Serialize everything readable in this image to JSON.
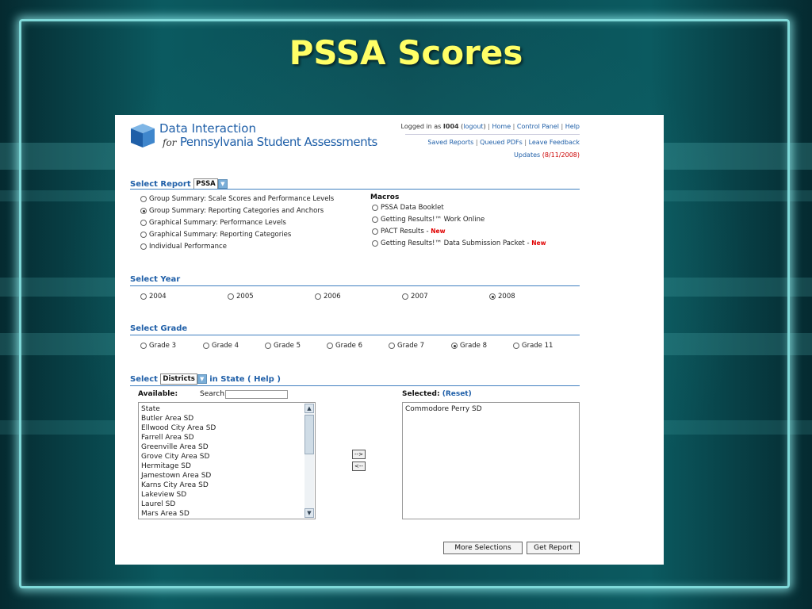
{
  "slide": {
    "title": "PSSA Scores"
  },
  "header": {
    "brand_line1": "Data Interaction",
    "brand_for": "for",
    "brand_line2": "Pennsylvania Student Assessments",
    "logged_in_prefix": "Logged in as",
    "user_id": "I004",
    "logout": "logout",
    "home": "Home",
    "control_panel": "Control Panel",
    "help": "Help",
    "saved_reports": "Saved Reports",
    "queued_pdfs": "Queued PDFs",
    "leave_feedback": "Leave Feedback",
    "updates": "Updates",
    "updates_date": "(8/11/2008)"
  },
  "select_report": {
    "label": "Select Report",
    "value": "PSSA",
    "options": [
      {
        "label": "Group Summary: Scale Scores and Performance Levels",
        "checked": false
      },
      {
        "label": "Group Summary: Reporting Categories and Anchors",
        "checked": true
      },
      {
        "label": "Graphical Summary: Performance Levels",
        "checked": false
      },
      {
        "label": "Graphical Summary: Reporting Categories",
        "checked": false
      },
      {
        "label": "Individual Performance",
        "checked": false
      }
    ],
    "macros_label": "Macros",
    "macros": [
      {
        "label": "PSSA Data Booklet",
        "new": ""
      },
      {
        "label": "Getting Results!™ Work Online",
        "new": ""
      },
      {
        "label": "PACT Results - ",
        "new": "New"
      },
      {
        "label": "Getting Results!™ Data Submission Packet - ",
        "new": "New"
      }
    ]
  },
  "select_year": {
    "label": "Select Year",
    "options": [
      {
        "label": "2004",
        "checked": false
      },
      {
        "label": "2005",
        "checked": false
      },
      {
        "label": "2006",
        "checked": false
      },
      {
        "label": "2007",
        "checked": false
      },
      {
        "label": "2008",
        "checked": true
      }
    ]
  },
  "select_grade": {
    "label": "Select Grade",
    "options": [
      {
        "label": "Grade 3",
        "checked": false
      },
      {
        "label": "Grade 4",
        "checked": false
      },
      {
        "label": "Grade 5",
        "checked": false
      },
      {
        "label": "Grade 6",
        "checked": false
      },
      {
        "label": "Grade 7",
        "checked": false
      },
      {
        "label": "Grade 8",
        "checked": true
      },
      {
        "label": "Grade 11",
        "checked": false
      }
    ]
  },
  "select_scope": {
    "label_prefix": "Select",
    "value": "Districts",
    "label_suffix": "in State (",
    "help": "Help",
    "close_paren": ")",
    "available_label": "Available:",
    "search_label": "Search:",
    "search_value": "",
    "selected_label": "Selected:",
    "reset": "(Reset)",
    "available": [
      "State",
      "Butler Area SD",
      "Ellwood City Area SD",
      "Farrell Area SD",
      "Greenville Area SD",
      "Grove City Area SD",
      "Hermitage SD",
      "Jamestown Area SD",
      "Karns City Area SD",
      "Lakeview SD",
      "Laurel SD",
      "Mars Area SD"
    ],
    "selected": [
      "Commodore Perry SD"
    ],
    "add_btn": "-->",
    "remove_btn": "<--"
  },
  "footer": {
    "more_selections": "More Selections",
    "get_report": "Get Report"
  }
}
